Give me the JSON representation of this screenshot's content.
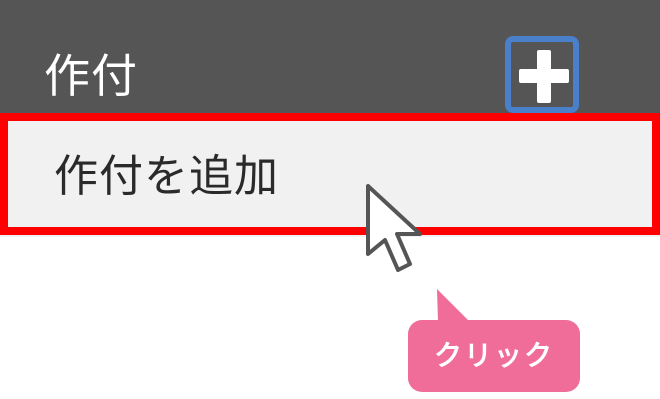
{
  "header": {
    "title": "作付",
    "add_icon": "plus-icon",
    "add_button_border_color": "#4a7fc9"
  },
  "menu": {
    "item_label": "作付を追加",
    "highlight_color": "#ff0000"
  },
  "annotation": {
    "cursor_icon": "arrow-cursor-icon",
    "callout_label": "クリック",
    "callout_color": "#ef6d98"
  }
}
